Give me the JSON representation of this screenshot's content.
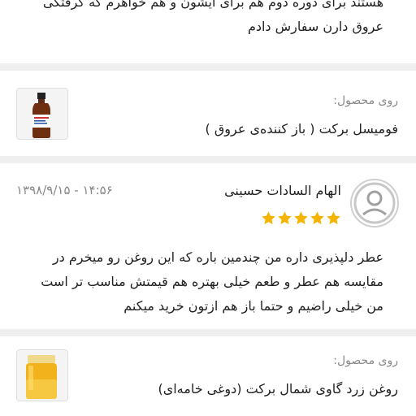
{
  "reviews_before": {
    "partial_line": "هستند برای دوره دوم هم برای ایشون و هم خواهرم که گرفتگی",
    "last_line": "عروق دارن سفارش دادم"
  },
  "product_1": {
    "label": "روی محصول:",
    "name": "فومیسل برکت ( باز کننده‌ی عروق )",
    "thumb_icon": "syrup-bottle-icon"
  },
  "review": {
    "author": "الهام السادات حسینی",
    "datetime": "۱۳۹۸/۹/۱۵ - ۱۴:۵۶",
    "rating": 5,
    "rating_max": 5,
    "star_color": "#f5b400",
    "text": "عطر دلپذیری داره من چندمین باره که این روغن رو میخرم در مقایسه هم عطر و طعم خیلی بهتره هم قیمتش مناسب تر است من خیلی راضیم و حتما باز هم ازتون خرید میکنم"
  },
  "product_2": {
    "label": "روی محصول:",
    "name": "روغن زرد گاوی شمال برکت (دوغی خامه‌ای)",
    "thumb_icon": "butter-jar-icon"
  }
}
